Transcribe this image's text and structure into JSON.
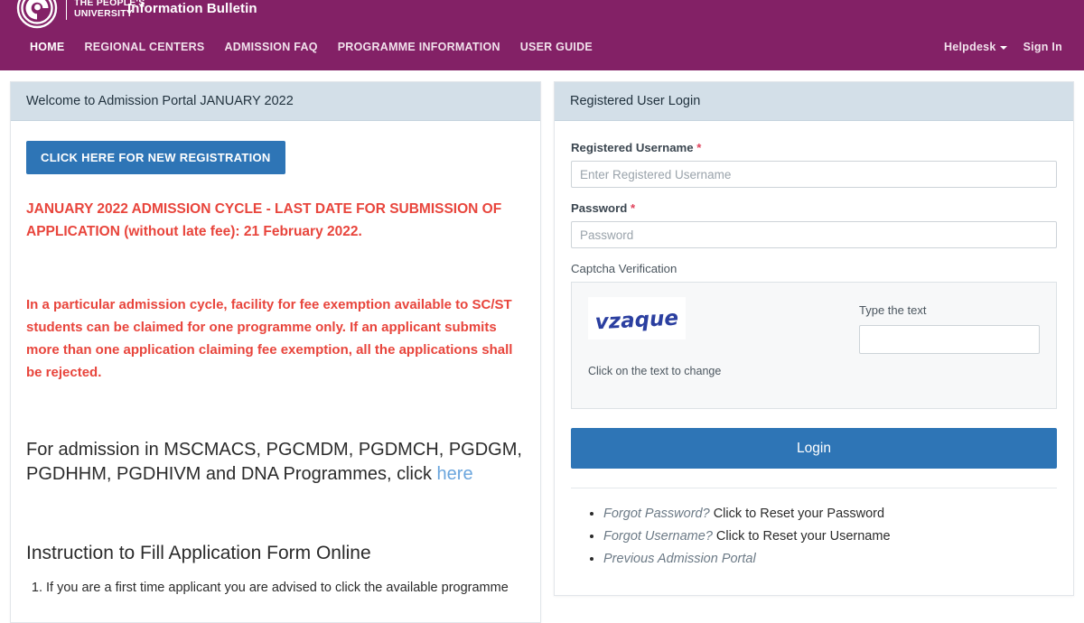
{
  "header": {
    "logo_icon": "ignou-spiral-logo",
    "brand_line1": "THE PEOPLE'S",
    "brand_line2": "UNIVERSITY",
    "bulletin_title": "Information Bulletin",
    "nav_items": [
      {
        "label": "HOME",
        "active": true
      },
      {
        "label": "REGIONAL CENTERS",
        "active": false
      },
      {
        "label": "ADMISSION FAQ",
        "active": false
      },
      {
        "label": "PROGRAMME INFORMATION",
        "active": false
      },
      {
        "label": "USER GUIDE",
        "active": false
      }
    ],
    "helpdesk_label": "Helpdesk",
    "signin_label": "Sign In",
    "brand_color": "#832166"
  },
  "left_panel": {
    "card_title": "Welcome to Admission Portal JANUARY 2022",
    "register_button": "CLICK HERE FOR NEW REGISTRATION",
    "notice_1": "JANUARY 2022 ADMISSION CYCLE - LAST DATE FOR SUBMISSION OF APPLICATION (without late fee): 21 February 2022.",
    "notice_2": "In a particular admission cycle, facility for fee exemption available to SC/ST students can be claimed for one programme only. If an applicant submits more than one application claiming fee exemption, all the applications shall be rejected.",
    "programme_note_text": "For admission in MSCMACS, PGCMDM, PGDMCH, PGDGM, PGDHHM, PGDHIVM and DNA Programmes, click ",
    "programme_note_link": "here",
    "instruction_heading": "Instruction to Fill Application Form Online",
    "instruction_items": [
      "If you are a first time applicant you are advised to click the available programme"
    ],
    "notice_color": "#e8453c",
    "link_color": "#6aa5dd",
    "button_color": "#2e75b6"
  },
  "right_panel": {
    "card_title": "Registered User Login",
    "username_label": "Registered Username",
    "username_required_mark": "*",
    "username_placeholder": "Enter Registered Username",
    "username_value": "",
    "password_label": "Password",
    "password_required_mark": "*",
    "password_placeholder": "Password",
    "password_value": "",
    "captcha_label": "Captcha Verification",
    "captcha_text": "vzaque",
    "captcha_hint": "Click on the text to change",
    "captcha_type_label": "Type the text",
    "captcha_input_value": "",
    "captcha_text_color": "#2b3fa0",
    "login_button": "Login",
    "footer_links": [
      {
        "link": "Forgot Password?",
        "tail": " Click to Reset your Password"
      },
      {
        "link": "Forgot Username?",
        "tail": " Click to Reset your Username"
      },
      {
        "link": "Previous Admission Portal",
        "tail": ""
      }
    ]
  }
}
